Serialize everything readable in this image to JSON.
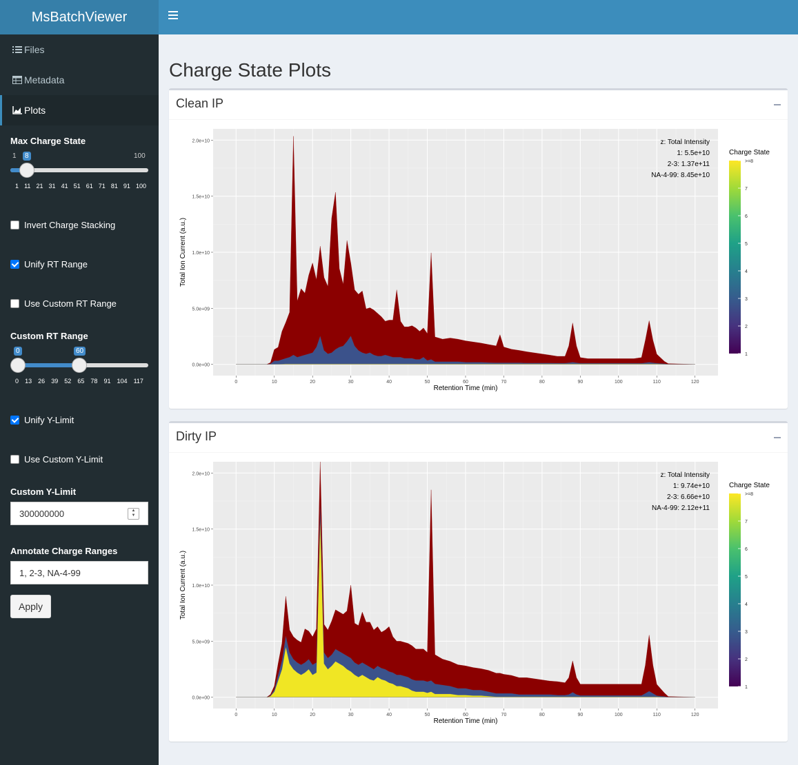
{
  "app": {
    "title": "MsBatchViewer"
  },
  "menu": [
    {
      "label": "Files",
      "icon": "list-icon"
    },
    {
      "label": "Metadata",
      "icon": "table-icon"
    },
    {
      "label": "Plots",
      "icon": "area-chart-icon"
    }
  ],
  "controls": {
    "max_charge": {
      "label": "Max Charge State",
      "min": "1",
      "max": "100",
      "value": "8",
      "ticks": [
        "1",
        "11",
        "21",
        "31",
        "41",
        "51",
        "61",
        "71",
        "81",
        "91",
        "100"
      ]
    },
    "invert": {
      "label": "Invert Charge Stacking",
      "checked": false
    },
    "unify_rt": {
      "label": "Unify RT Range",
      "checked": true
    },
    "custom_rt": {
      "label": "Use Custom RT Range",
      "checked": false
    },
    "rt_range": {
      "label": "Custom RT Range",
      "from": "0",
      "to": "60",
      "ticks": [
        "0",
        "13",
        "26",
        "39",
        "52",
        "65",
        "78",
        "91",
        "104",
        "117"
      ]
    },
    "unify_y": {
      "label": "Unify Y-Limit",
      "checked": true
    },
    "custom_y": {
      "label": "Use Custom Y-Limit",
      "checked": false
    },
    "y_limit": {
      "label": "Custom Y-Limit",
      "value": "300000000"
    },
    "annotate": {
      "label": "Annotate Charge Ranges",
      "value": "1, 2-3, NA-4-99"
    },
    "apply": "Apply"
  },
  "page_title": "Charge State Plots",
  "colors": {
    "accent": "#3c8dbc",
    "dark": "#222d32",
    "maroon": "#8b0000",
    "yellow": "#f0e624"
  },
  "plots": [
    {
      "title": "Clean IP",
      "xlabel": "Retention Time (min)",
      "ylabel": "Total Ion Current (a.u.)",
      "legend_title": "Charge State",
      "annot": [
        "z: Total Intensity",
        "1: 5.5e+10",
        "2-3: 1.37e+11",
        "NA-4-99: 8.45e+10"
      ]
    },
    {
      "title": "Dirty IP",
      "xlabel": "Retention Time (min)",
      "ylabel": "Total Ion Current (a.u.)",
      "legend_title": "Charge State",
      "annot": [
        "z: Total Intensity",
        "1: 9.74e+10",
        "2-3: 6.66e+10",
        "NA-4-99: 2.12e+11"
      ]
    }
  ],
  "axis": {
    "yticks": [
      "0.0e+00",
      "5.0e+09",
      "1.0e+10",
      "1.5e+10",
      "2.0e+10"
    ],
    "xticks": [
      "0",
      "10",
      "20",
      "30",
      "40",
      "50",
      "60",
      "70",
      "80",
      "90",
      "100",
      "110",
      "120"
    ],
    "legend_ticks": [
      ">=8",
      "7",
      "6",
      "5",
      "4",
      "3",
      "2",
      "1"
    ]
  },
  "chart_data": [
    {
      "type": "area",
      "title": "Clean IP",
      "xlabel": "Retention Time (min)",
      "ylabel": "Total Ion Current (a.u.)",
      "xlim": [
        -6,
        126
      ],
      "ylim": [
        -1000000000.0,
        21000000000.0
      ],
      "grid": true,
      "legend": "right",
      "x": [
        0,
        8,
        9,
        10,
        11,
        12,
        13,
        14,
        15,
        16,
        17,
        18,
        19,
        20,
        21,
        22,
        23,
        24,
        25,
        26,
        27,
        28,
        29,
        30,
        31,
        32,
        33,
        34,
        35,
        36,
        37,
        38,
        39,
        40,
        41,
        42,
        43,
        44,
        45,
        46,
        47,
        48,
        49,
        50,
        51,
        52,
        54,
        56,
        58,
        60,
        62,
        64,
        66,
        68,
        69,
        70,
        72,
        74,
        76,
        78,
        80,
        82,
        84,
        86,
        87,
        88,
        89,
        90,
        92,
        94,
        96,
        98,
        100,
        102,
        104,
        106,
        107,
        108,
        109,
        110,
        112,
        113,
        120
      ],
      "series": [
        {
          "name": "1",
          "values": [
            0,
            0,
            10000000.0,
            30000000.0,
            30000000.0,
            40000000.0,
            50000000.0,
            50000000.0,
            50000000.0,
            50000000.0,
            50000000.0,
            50000000.0,
            50000000.0,
            50000000.0,
            50000000.0,
            50000000.0,
            50000000.0,
            50000000.0,
            50000000.0,
            50000000.0,
            50000000.0,
            50000000.0,
            50000000.0,
            50000000.0,
            50000000.0,
            50000000.0,
            50000000.0,
            50000000.0,
            50000000.0,
            50000000.0,
            50000000.0,
            50000000.0,
            50000000.0,
            50000000.0,
            50000000.0,
            50000000.0,
            50000000.0,
            50000000.0,
            50000000.0,
            50000000.0,
            50000000.0,
            50000000.0,
            50000000.0,
            50000000.0,
            50000000.0,
            50000000.0,
            50000000.0,
            50000000.0,
            50000000.0,
            50000000.0,
            50000000.0,
            50000000.0,
            50000000.0,
            50000000.0,
            50000000.0,
            50000000.0,
            50000000.0,
            50000000.0,
            50000000.0,
            50000000.0,
            50000000.0,
            50000000.0,
            50000000.0,
            50000000.0,
            50000000.0,
            50000000.0,
            50000000.0,
            50000000.0,
            50000000.0,
            50000000.0,
            50000000.0,
            50000000.0,
            50000000.0,
            50000000.0,
            50000000.0,
            50000000.0,
            50000000.0,
            50000000.0,
            50000000.0,
            50000000.0,
            30000000.0,
            10000000.0,
            0
          ]
        },
        {
          "name": "2-3",
          "values": [
            0,
            0,
            50000000.0,
            300000000.0,
            300000000.0,
            400000000.0,
            500000000.0,
            600000000.0,
            800000000.0,
            600000000.0,
            700000000.0,
            800000000.0,
            900000000.0,
            1000000000.0,
            1500000000.0,
            2500000000.0,
            1200000000.0,
            900000000.0,
            1000000000.0,
            1300000000.0,
            1500000000.0,
            1600000000.0,
            2000000000.0,
            2500000000.0,
            1600000000.0,
            1200000000.0,
            1000000000.0,
            900000000.0,
            1000000000.0,
            800000000.0,
            700000000.0,
            700000000.0,
            800000000.0,
            700000000.0,
            600000000.0,
            600000000.0,
            600000000.0,
            500000000.0,
            500000000.0,
            500000000.0,
            400000000.0,
            400000000.0,
            600000000.0,
            300000000.0,
            400000000.0,
            200000000.0,
            200000000.0,
            200000000.0,
            200000000.0,
            150000000.0,
            150000000.0,
            150000000.0,
            120000000.0,
            100000000.0,
            100000000.0,
            100000000.0,
            100000000.0,
            100000000.0,
            80000000.0,
            80000000.0,
            80000000.0,
            80000000.0,
            70000000.0,
            70000000.0,
            100000000.0,
            150000000.0,
            100000000.0,
            60000000.0,
            60000000.0,
            60000000.0,
            60000000.0,
            60000000.0,
            60000000.0,
            60000000.0,
            60000000.0,
            60000000.0,
            100000000.0,
            150000000.0,
            100000000.0,
            60000000.0,
            40000000.0,
            10000000.0,
            0
          ]
        },
        {
          "name": "NA-4-99",
          "values": [
            0,
            0,
            100000000.0,
            1000000000.0,
            1200000000.0,
            2500000000.0,
            3200000000.0,
            4000000000.0,
            19500000000.0,
            5000000000.0,
            6000000000.0,
            5500000000.0,
            7000000000.0,
            8000000000.0,
            6000000000.0,
            8000000000.0,
            6500000000.0,
            6000000000.0,
            12000000000.0,
            14000000000.0,
            7000000000.0,
            5500000000.0,
            9000000000.0,
            6500000000.0,
            5000000000.0,
            5000000000.0,
            5500000000.0,
            4000000000.0,
            4000000000.0,
            4000000000.0,
            3800000000.0,
            3500000000.0,
            3000000000.0,
            3200000000.0,
            3300000000.0,
            6000000000.0,
            3200000000.0,
            2800000000.0,
            2800000000.0,
            2900000000.0,
            2800000000.0,
            2500000000.0,
            2600000000.0,
            2400000000.0,
            9500000000.0,
            2200000000.0,
            2000000000.0,
            2100000000.0,
            2000000000.0,
            1900000000.0,
            1800000000.0,
            1700000000.0,
            1600000000.0,
            1500000000.0,
            2500000000.0,
            1400000000.0,
            1200000000.0,
            1100000000.0,
            1000000000.0,
            900000000.0,
            800000000.0,
            700000000.0,
            600000000.0,
            600000000.0,
            1500000000.0,
            3500000000.0,
            1500000000.0,
            500000000.0,
            400000000.0,
            400000000.0,
            400000000.0,
            400000000.0,
            400000000.0,
            400000000.0,
            400000000.0,
            500000000.0,
            2000000000.0,
            3700000000.0,
            2000000000.0,
            800000000.0,
            200000000.0,
            50000000.0,
            0
          ]
        }
      ]
    },
    {
      "type": "area",
      "title": "Dirty IP",
      "xlabel": "Retention Time (min)",
      "ylabel": "Total Ion Current (a.u.)",
      "xlim": [
        -6,
        126
      ],
      "ylim": [
        -1000000000.0,
        21000000000.0
      ],
      "grid": true,
      "legend": "right",
      "x": [
        0,
        8,
        9,
        10,
        11,
        12,
        13,
        14,
        15,
        16,
        17,
        18,
        19,
        20,
        21,
        22,
        23,
        24,
        25,
        26,
        27,
        28,
        29,
        30,
        31,
        32,
        33,
        34,
        35,
        36,
        37,
        38,
        39,
        40,
        41,
        42,
        43,
        44,
        45,
        46,
        47,
        48,
        49,
        50,
        51,
        52,
        54,
        56,
        58,
        60,
        62,
        64,
        66,
        68,
        69,
        70,
        72,
        74,
        76,
        78,
        80,
        82,
        84,
        86,
        87,
        88,
        89,
        90,
        92,
        94,
        96,
        98,
        100,
        102,
        104,
        106,
        107,
        108,
        109,
        110,
        112,
        113,
        120
      ],
      "series": [
        {
          "name": "1",
          "values": [
            0,
            0,
            100000000.0,
            500000000.0,
            1500000000.0,
            2500000000.0,
            4500000000.0,
            3000000000.0,
            2500000000.0,
            2200000000.0,
            2000000000.0,
            2200000000.0,
            2500000000.0,
            2000000000.0,
            2200000000.0,
            16000000000.0,
            3000000000.0,
            2500000000.0,
            2800000000.0,
            3200000000.0,
            3000000000.0,
            2800000000.0,
            2500000000.0,
            2300000000.0,
            2000000000.0,
            1800000000.0,
            2000000000.0,
            1800000000.0,
            1600000000.0,
            1500000000.0,
            1800000000.0,
            1600000000.0,
            1500000000.0,
            1300000000.0,
            1200000000.0,
            1000000000.0,
            1000000000.0,
            900000000.0,
            800000000.0,
            600000000.0,
            500000000.0,
            500000000.0,
            500000000.0,
            400000000.0,
            500000000.0,
            300000000.0,
            300000000.0,
            300000000.0,
            200000000.0,
            200000000.0,
            150000000.0,
            150000000.0,
            100000000.0,
            50000000.0,
            50000000.0,
            50000000.0,
            50000000.0,
            50000000.0,
            50000000.0,
            50000000.0,
            50000000.0,
            50000000.0,
            50000000.0,
            50000000.0,
            50000000.0,
            50000000.0,
            50000000.0,
            50000000.0,
            50000000.0,
            50000000.0,
            50000000.0,
            50000000.0,
            50000000.0,
            50000000.0,
            50000000.0,
            50000000.0,
            50000000.0,
            50000000.0,
            50000000.0,
            50000000.0,
            30000000.0,
            10000000.0,
            0
          ]
        },
        {
          "name": "2-3",
          "values": [
            0,
            0,
            50000000.0,
            200000000.0,
            500000000.0,
            800000000.0,
            1000000000.0,
            1000000000.0,
            900000000.0,
            900000000.0,
            900000000.0,
            900000000.0,
            900000000.0,
            900000000.0,
            900000000.0,
            1500000000.0,
            1000000000.0,
            1000000000.0,
            1000000000.0,
            1100000000.0,
            1100000000.0,
            1100000000.0,
            1200000000.0,
            1200000000.0,
            1100000000.0,
            1100000000.0,
            1100000000.0,
            1100000000.0,
            1100000000.0,
            1000000000.0,
            1000000000.0,
            1000000000.0,
            1000000000.0,
            1000000000.0,
            1000000000.0,
            1000000000.0,
            1000000000.0,
            1000000000.0,
            1000000000.0,
            1000000000.0,
            1000000000.0,
            1000000000.0,
            1000000000.0,
            1000000000.0,
            1000000000.0,
            900000000.0,
            800000000.0,
            700000000.0,
            600000000.0,
            600000000.0,
            500000000.0,
            500000000.0,
            400000000.0,
            300000000.0,
            300000000.0,
            300000000.0,
            300000000.0,
            200000000.0,
            200000000.0,
            200000000.0,
            200000000.0,
            200000000.0,
            150000000.0,
            150000000.0,
            200000000.0,
            400000000.0,
            200000000.0,
            120000000.0,
            120000000.0,
            120000000.0,
            120000000.0,
            120000000.0,
            120000000.0,
            120000000.0,
            120000000.0,
            120000000.0,
            300000000.0,
            500000000.0,
            300000000.0,
            100000000.0,
            50000000.0,
            10000000.0,
            0
          ]
        },
        {
          "name": "NA-4-99",
          "values": [
            0,
            0,
            100000000.0,
            300000000.0,
            1000000000.0,
            1500000000.0,
            3500000000.0,
            2000000000.0,
            2000000000.0,
            2000000000.0,
            2000000000.0,
            3000000000.0,
            2500000000.0,
            2500000000.0,
            3000000000.0,
            3500000000.0,
            2500000000.0,
            2500000000.0,
            3000000000.0,
            3500000000.0,
            3500000000.0,
            3500000000.0,
            4000000000.0,
            6500000000.0,
            3500000000.0,
            3500000000.0,
            4500000000.0,
            3800000000.0,
            4000000000.0,
            3500000000.0,
            3500000000.0,
            3200000000.0,
            3500000000.0,
            4000000000.0,
            3200000000.0,
            3000000000.0,
            3000000000.0,
            3000000000.0,
            3000000000.0,
            3000000000.0,
            2800000000.0,
            2800000000.0,
            2800000000.0,
            2600000000.0,
            17000000000.0,
            2600000000.0,
            2300000000.0,
            2200000000.0,
            2100000000.0,
            2000000000.0,
            2000000000.0,
            1900000000.0,
            1900000000.0,
            1800000000.0,
            1800000000.0,
            1700000000.0,
            1600000000.0,
            1500000000.0,
            1500000000.0,
            1400000000.0,
            1300000000.0,
            1200000000.0,
            1200000000.0,
            1100000000.0,
            1500000000.0,
            2800000000.0,
            1500000000.0,
            1000000000.0,
            1000000000.0,
            1000000000.0,
            1000000000.0,
            1000000000.0,
            1000000000.0,
            1000000000.0,
            1000000000.0,
            1000000000.0,
            2500000000.0,
            5000000000.0,
            2500000000.0,
            1000000000.0,
            300000000.0,
            50000000.0,
            0
          ]
        }
      ]
    }
  ]
}
